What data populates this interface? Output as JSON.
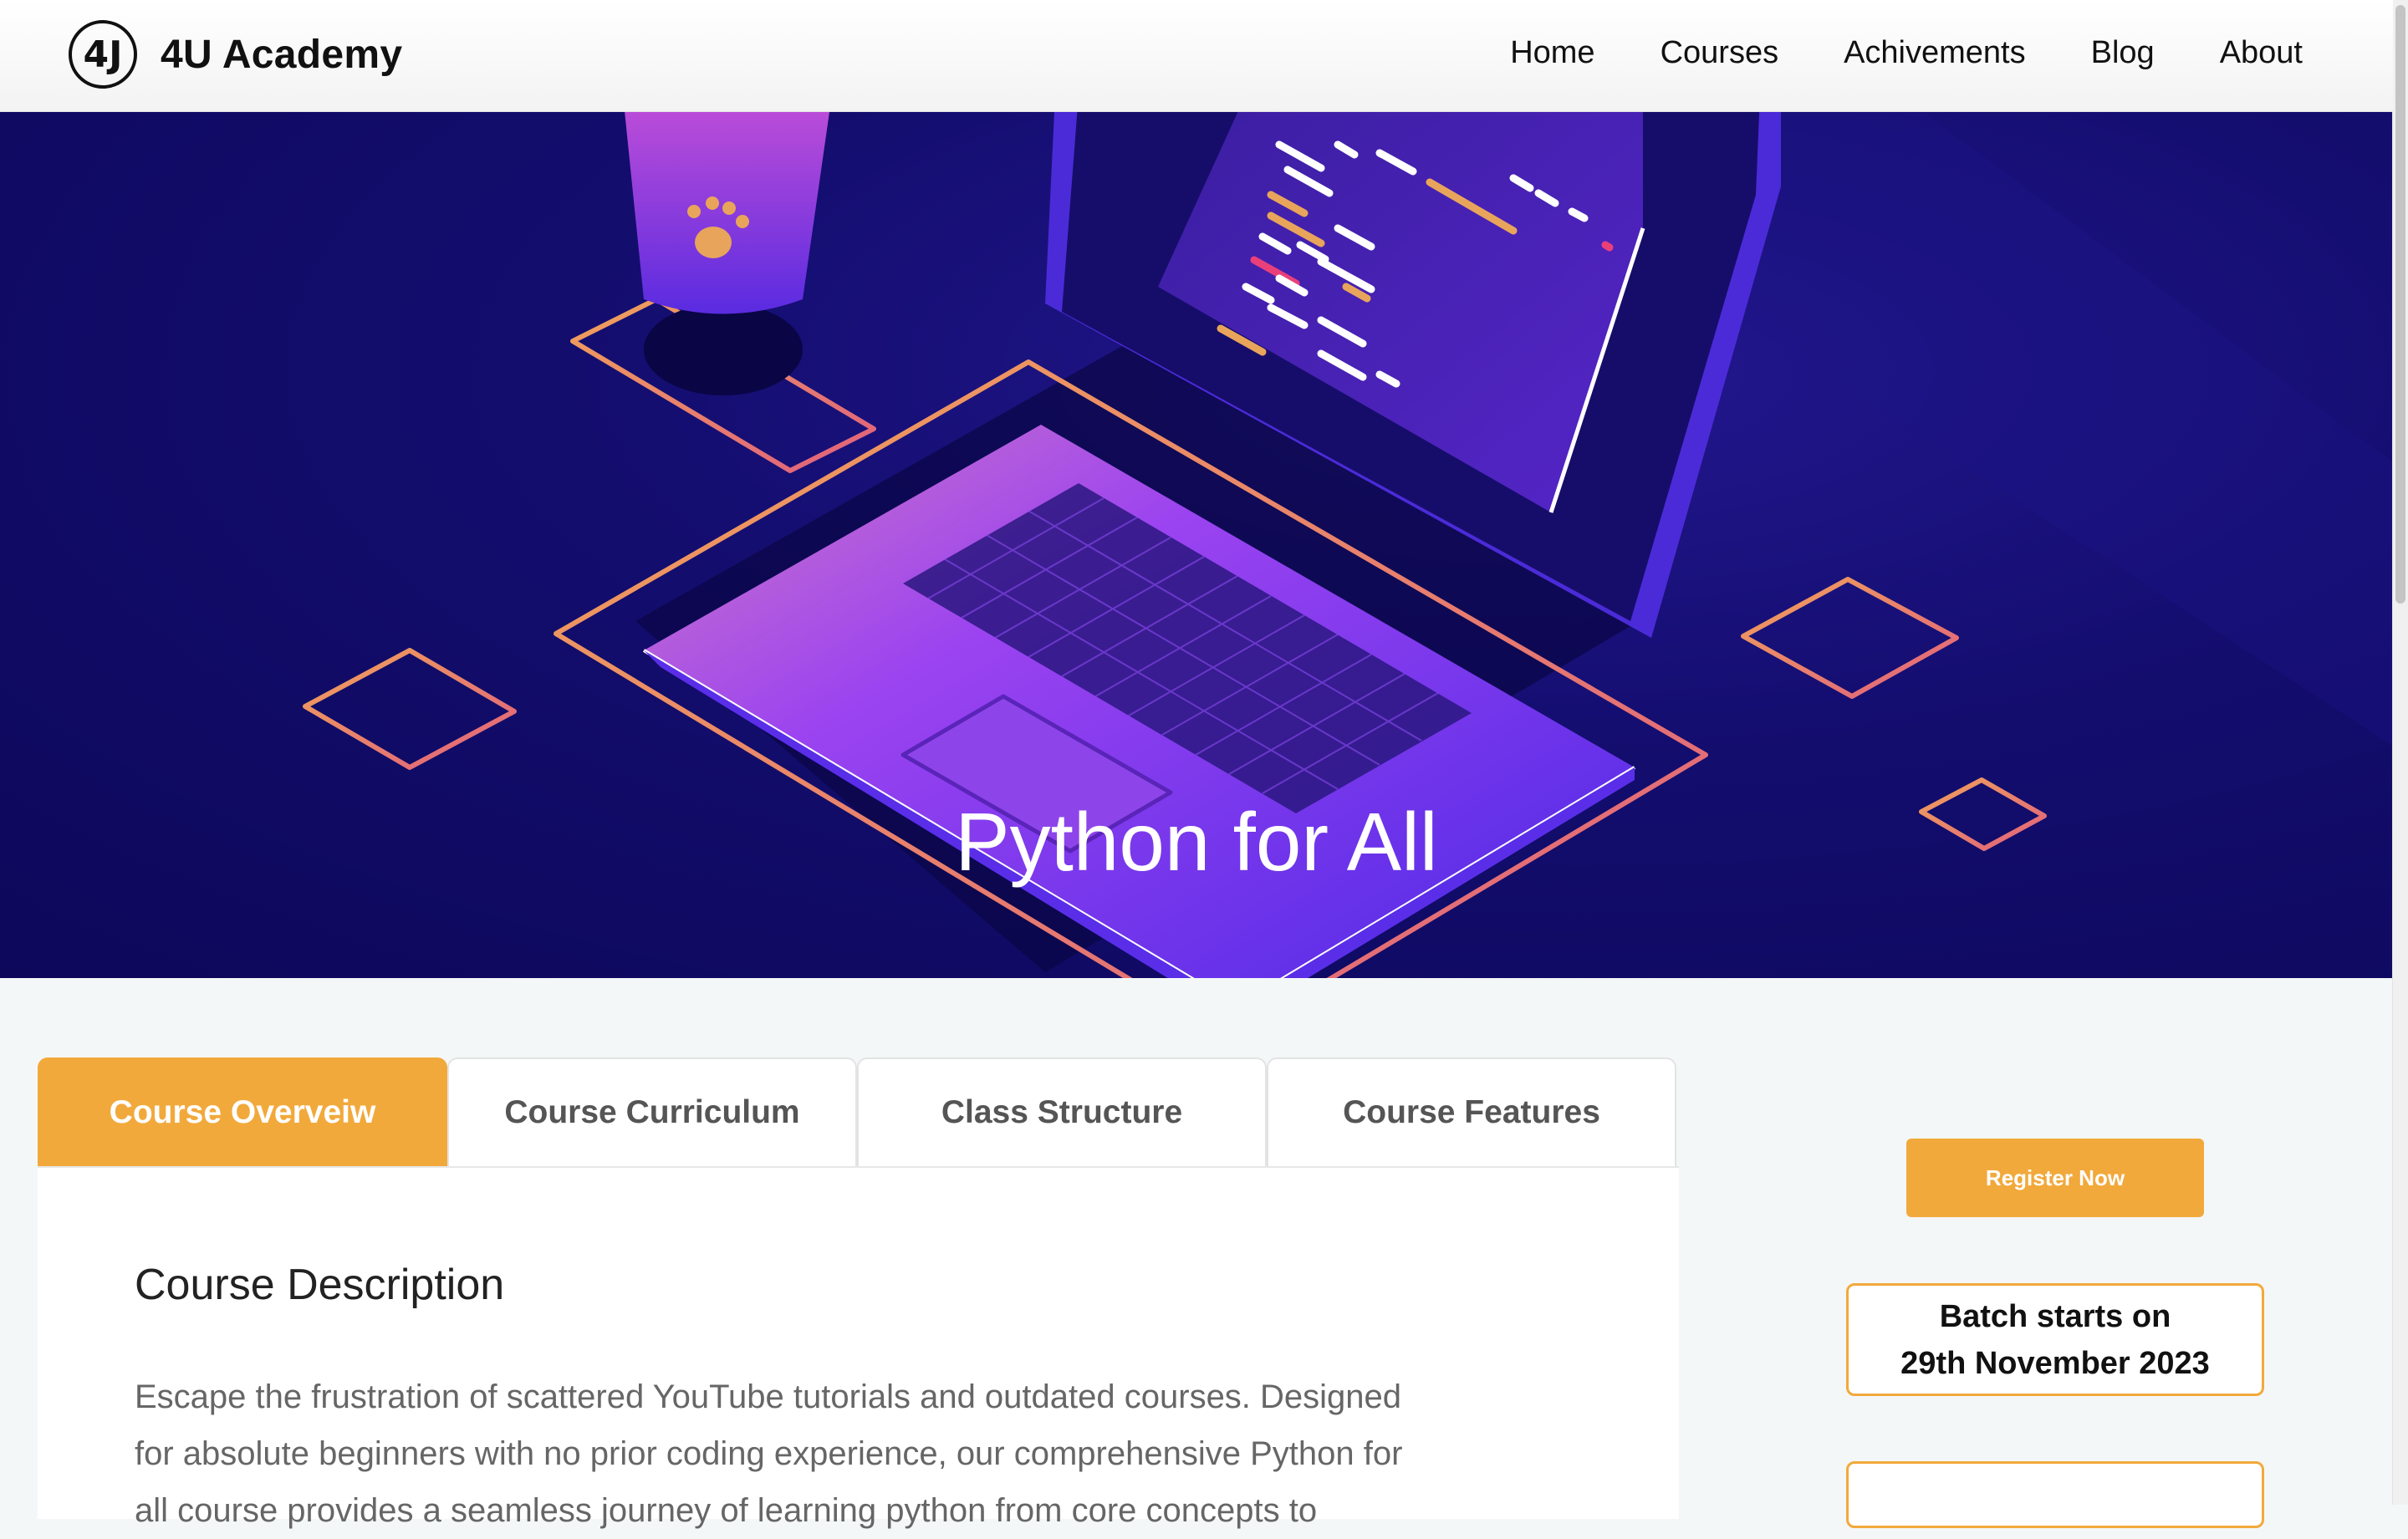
{
  "brand": {
    "logo_text": "4J",
    "name": "4U Academy"
  },
  "nav": {
    "items": [
      "Home",
      "Courses",
      "Achivements",
      "Blog",
      "About"
    ]
  },
  "hero": {
    "title": "Python for All"
  },
  "tabs": [
    {
      "label": "Course Overveiw",
      "active": true
    },
    {
      "label": "Course Curriculum",
      "active": false
    },
    {
      "label": "Class Structure",
      "active": false
    },
    {
      "label": "Course Features",
      "active": false
    }
  ],
  "content": {
    "heading": "Course Description",
    "paragraph": "Escape the frustration of scattered YouTube tutorials and outdated courses. Designed for absolute beginners with no prior coding experience, our comprehensive Python for all course provides a seamless journey of learning python from core concepts to"
  },
  "sidebar": {
    "register_label": "Register Now",
    "batch_line1": "Batch starts on",
    "batch_line2": "29th November 2023"
  },
  "colors": {
    "accent": "#f2a93b",
    "hero_bg": "#130d6e",
    "text_dark": "#111111"
  },
  "icons": {
    "logo": "4u-logo-icon",
    "paw": "paw-icon"
  }
}
